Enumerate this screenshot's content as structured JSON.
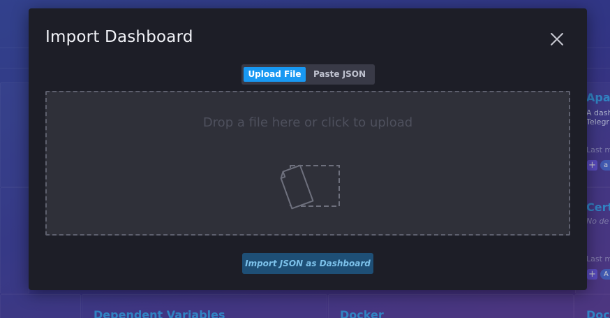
{
  "modal": {
    "title": "Import Dashboard",
    "close_icon": "close-icon",
    "toggle": {
      "options": [
        {
          "label": "Upload File",
          "active": true
        },
        {
          "label": "Paste JSON",
          "active": false
        }
      ]
    },
    "dropzone": {
      "text": "Drop a file here or click to upload",
      "icon": "file-upload-icon"
    },
    "import_button": {
      "label": "Import JSON as Dashboard"
    }
  },
  "background": {
    "cards": [
      {
        "title": "Apac",
        "description_lines": [
          "A dash",
          "Telegr"
        ],
        "meta": "Last m",
        "label_badge": "a"
      },
      {
        "title": "Cert",
        "no_description": "No de",
        "meta": "Last m",
        "label_badge": "A"
      }
    ],
    "bottom_titles": [
      "Dependent Variables",
      "Docker",
      "Dock"
    ]
  },
  "colors": {
    "modal_background": "#1d1e27",
    "toggle_active": "#1898f2",
    "import_button": "#1e4f76",
    "card_title": "#3aa3ee",
    "add_button": "#6c5ae6"
  }
}
